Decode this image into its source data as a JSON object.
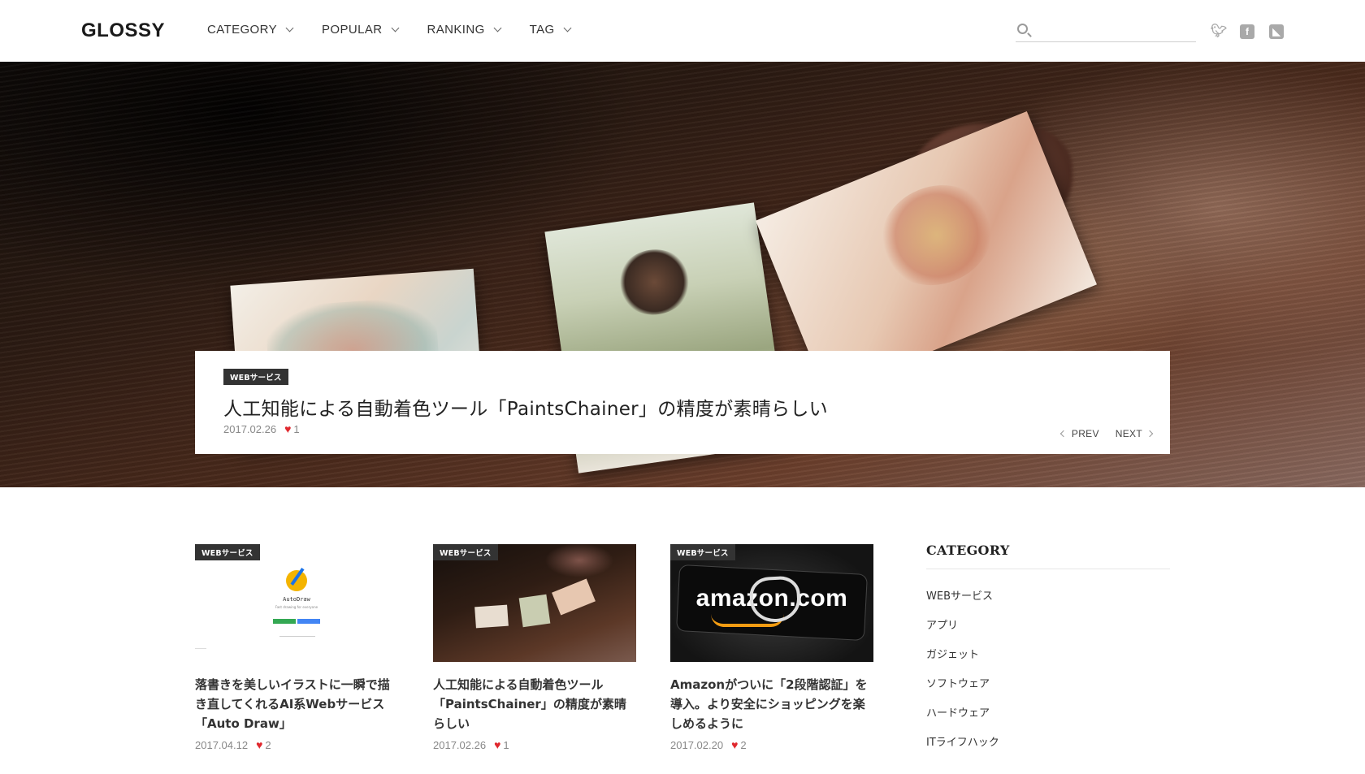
{
  "header": {
    "logo": "GLOSSY",
    "nav": [
      {
        "label": "CATEGORY"
      },
      {
        "label": "POPULAR"
      },
      {
        "label": "RANKING"
      },
      {
        "label": "TAG"
      }
    ],
    "search_placeholder": "",
    "social": [
      "twitter-icon",
      "facebook-icon",
      "rss-icon"
    ]
  },
  "feature": {
    "category": "WEBサービス",
    "title": "人工知能による自動着色ツール「PaintsChainer」の精度が素晴らしい",
    "date": "2017.02.26",
    "likes": "1",
    "prev_label": "PREV",
    "next_label": "NEXT"
  },
  "posts": [
    {
      "category": "WEBサービス",
      "title": "落書きを美しいイラストに一瞬で描き直してくれるAI系Webサービス「Auto Draw」",
      "date": "2017.04.12",
      "likes": "2",
      "thumb_text": "AutoDraw",
      "thumb_sub": "Fast drawing for everyone"
    },
    {
      "category": "WEBサービス",
      "title": "人工知能による自動着色ツール「PaintsChainer」の精度が素晴らしい",
      "date": "2017.02.26",
      "likes": "1"
    },
    {
      "category": "WEBサービス",
      "title": "Amazonがついに「2段階認証」を導入。より安全にショッピングを楽しめるように",
      "date": "2017.02.20",
      "likes": "2",
      "thumb_text": "amazon.com"
    }
  ],
  "sidebar": {
    "title": "CATEGORY",
    "items": [
      "WEBサービス",
      "アプリ",
      "ガジェット",
      "ソフトウェア",
      "ハードウェア",
      "ITライフハック"
    ]
  },
  "colors": {
    "accent_heart": "#e0282e",
    "badge_bg": "#333333"
  }
}
